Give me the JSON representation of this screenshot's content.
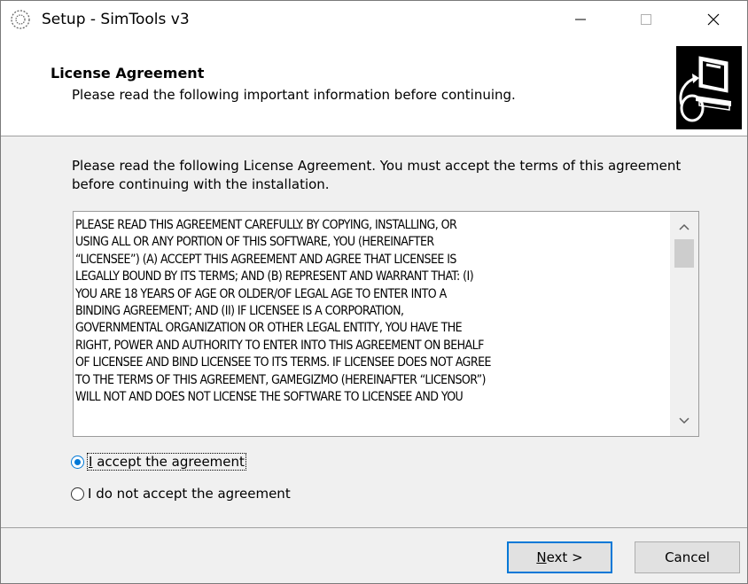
{
  "window": {
    "title": "Setup - SimTools v3",
    "controls": {
      "minimize": "—",
      "maximize": "☐",
      "close": "✕"
    }
  },
  "header": {
    "title": "License Agreement",
    "subtitle": "Please read the following important information before continuing."
  },
  "main": {
    "intro": "Please read the following License Agreement. You must accept the terms of this agreement before continuing with the installation.",
    "license_text": "PLEASE READ THIS AGREEMENT CAREFULLY. BY COPYING, INSTALLING, OR\nUSING ALL OR ANY PORTION OF THIS SOFTWARE, YOU (HEREINAFTER\n“LICENSEE”) (A) ACCEPT THIS AGREEMENT AND AGREE THAT LICENSEE IS\nLEGALLY BOUND BY ITS TERMS; AND (B) REPRESENT AND WARRANT THAT: (I)\nYOU ARE 18 YEARS OF AGE OR OLDER/OF LEGAL AGE TO ENTER INTO A\nBINDING AGREEMENT; AND (II) IF LICENSEE IS A CORPORATION,\nGOVERNMENTAL ORGANIZATION OR OTHER LEGAL ENTITY, YOU HAVE THE\nRIGHT, POWER AND AUTHORITY TO ENTER INTO THIS AGREEMENT ON BEHALF\nOF LICENSEE AND BIND LICENSEE TO ITS TERMS. IF LICENSEE DOES NOT AGREE\nTO THE TERMS OF THIS AGREEMENT, GAMEGIZMO (HEREINAFTER “LICENSOR”)\nWILL NOT AND DOES NOT LICENSE THE SOFTWARE TO LICENSEE AND YOU",
    "radio_accept": "I accept the agreement",
    "radio_decline": "I do not accept the agreement",
    "selected": "accept"
  },
  "footer": {
    "next_label": "Next >",
    "cancel_label": "Cancel"
  },
  "colors": {
    "accent": "#0078d7",
    "window_bg": "#f0f0f0",
    "header_bg": "#ffffff"
  },
  "icons": [
    "setup-app-icon",
    "computer-setup-logo-icon",
    "scroll-up-icon",
    "scroll-down-icon"
  ]
}
